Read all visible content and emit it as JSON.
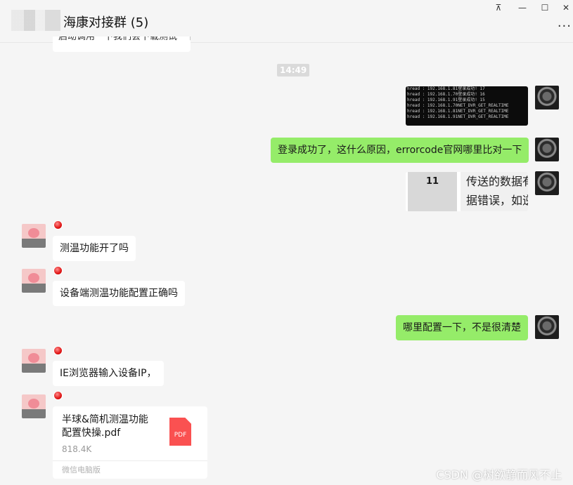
{
  "header": {
    "title": "海康对接群 (5)",
    "pin_icon": "pin-icon",
    "min_icon": "minimize-icon",
    "max_icon": "maximize-icon",
    "close_icon": "close-icon",
    "more_icon": "more-icon"
  },
  "partial_message": "启动调用一下我们会下载测试一下",
  "time_divider": "14:49",
  "terminal_lines": [
    "hread  : 192.168.1.81登录成功! 17",
    "hread  : 192.168.1.70登录成功! 16",
    "hread  : 192.168.1.91登录成功! 15",
    "hread  : 192.168.1.70NET_DVR_GET_REALTIME",
    "hread  : 192.168.1.81NET_DVR_GET_REALTIME",
    "hread  : 192.168.1.91NET_DVR_GET_REALTIME"
  ],
  "messages": {
    "login_ok": "登录成功了，这什么原因，errorcode官网哪里比对一下",
    "temp_enabled": "测温功能开了吗",
    "device_config": "设备端测温功能配置正确吗",
    "where_config": "哪里配置一下，不是很清楚",
    "ie_browser": "IE浏览器输入设备IP，"
  },
  "error_table": {
    "code": "11",
    "desc_line1": "传送的数据有",
    "desc_line2": "据错误，如逆"
  },
  "file": {
    "name_line1": "半球&简机测温功能",
    "name_line2": "配置快操.pdf",
    "size": "818.4K",
    "source": "微信电脑版",
    "type_label": "PDF"
  },
  "watermark": "CSDN @树欲静而风不止",
  "colors": {
    "green_bubble": "#95ec69",
    "white_bubble": "#ffffff",
    "background": "#f5f5f5",
    "pdf_red": "#fa5151"
  }
}
